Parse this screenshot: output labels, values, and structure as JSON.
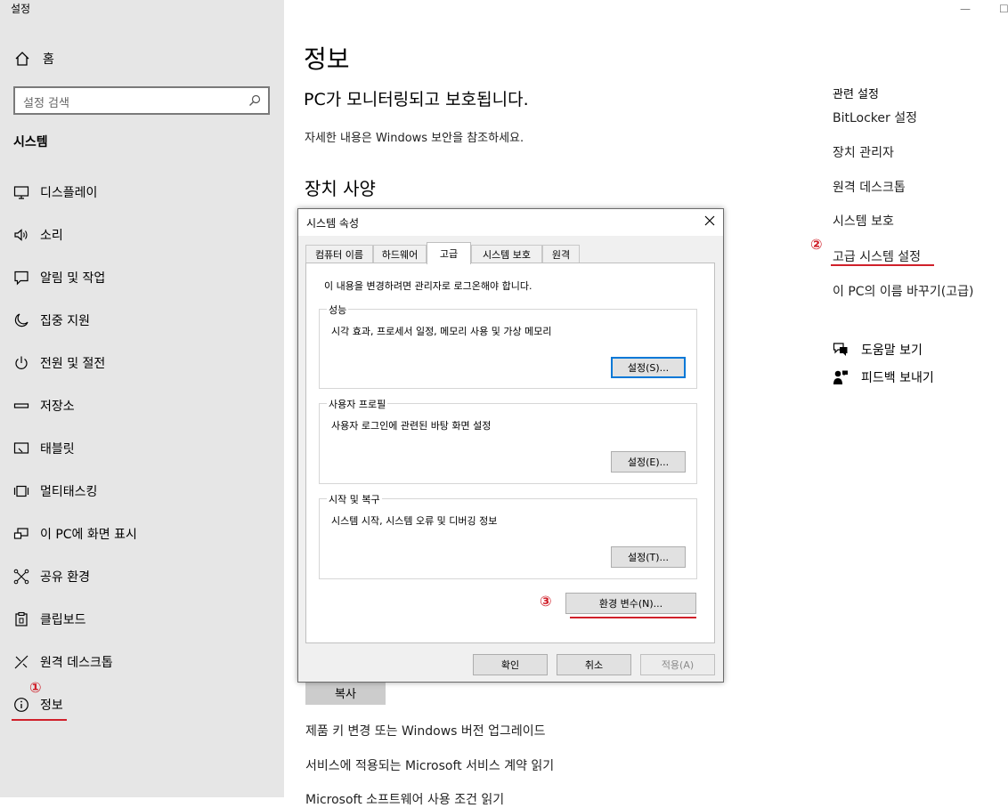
{
  "app": {
    "title": "설정",
    "minimize": "—",
    "maximize": "☐"
  },
  "sidebar": {
    "home_label": "홈",
    "search_placeholder": "설정 검색",
    "section_title": "시스템",
    "items": [
      {
        "label": "디스플레이",
        "icon": "monitor-icon"
      },
      {
        "label": "소리",
        "icon": "speaker-icon"
      },
      {
        "label": "알림 및 작업",
        "icon": "notification-icon"
      },
      {
        "label": "집중 지원",
        "icon": "moon-icon"
      },
      {
        "label": "전원 및 절전",
        "icon": "power-icon"
      },
      {
        "label": "저장소",
        "icon": "storage-icon"
      },
      {
        "label": "태블릿",
        "icon": "tablet-icon"
      },
      {
        "label": "멀티태스킹",
        "icon": "multitasking-icon"
      },
      {
        "label": "이 PC에 화면 표시",
        "icon": "project-icon"
      },
      {
        "label": "공유 환경",
        "icon": "share-icon"
      },
      {
        "label": "클립보드",
        "icon": "clipboard-icon"
      },
      {
        "label": "원격 데스크톱",
        "icon": "remote-icon"
      },
      {
        "label": "정보",
        "icon": "info-icon"
      }
    ]
  },
  "annotations": {
    "m1": "①",
    "m2": "②",
    "m3": "③",
    "color": "#d0202a"
  },
  "main": {
    "title": "정보",
    "status": "PC가 모니터링되고 보호됩니다.",
    "security_link": "자세한 내용은 Windows 보안을 참조하세요.",
    "spec_title": "장치 사양",
    "copy_label": "복사",
    "links": [
      "제품 키 변경 또는 Windows 버전 업그레이드",
      "서비스에 적용되는 Microsoft 서비스 계약 읽기",
      "Microsoft 소프트웨어 사용 조건 읽기"
    ]
  },
  "related": {
    "title": "관련 설정",
    "links": [
      "BitLocker 설정",
      "장치 관리자",
      "원격 데스크톱",
      "시스템 보호",
      "고급 시스템 설정",
      "이 PC의 이름 바꾸기(고급)"
    ],
    "help": "도움말 보기",
    "feedback": "피드백 보내기"
  },
  "dialog": {
    "title": "시스템 속성",
    "tabs": [
      "컴퓨터 이름",
      "하드웨어",
      "고급",
      "시스템 보호",
      "원격"
    ],
    "admin_note": "이 내용을 변경하려면 관리자로 로그온해야 합니다.",
    "groups": [
      {
        "label": "성능",
        "desc": "시각 효과, 프로세서 일정, 메모리 사용 및 가상 메모리",
        "button": "설정(S)..."
      },
      {
        "label": "사용자 프로필",
        "desc": "사용자 로그인에 관련된 바탕 화면 설정",
        "button": "설정(E)..."
      },
      {
        "label": "시작 및 복구",
        "desc": "시스템 시작, 시스템 오류 및 디버깅 정보",
        "button": "설정(T)..."
      }
    ],
    "env_button": "환경 변수(N)...",
    "ok": "확인",
    "cancel": "취소",
    "apply": "적용(A)"
  }
}
